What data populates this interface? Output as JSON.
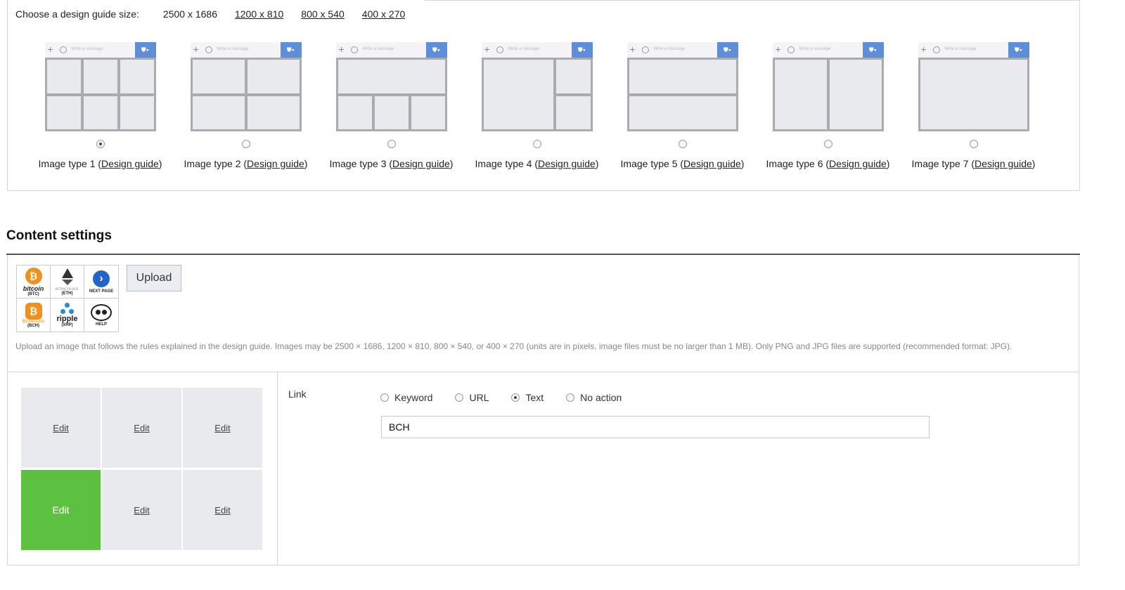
{
  "guide": {
    "size_label": "Choose a design guide size:",
    "sizes": [
      {
        "label": "2500 x 1686",
        "selected": true
      },
      {
        "label": "1200 x 810",
        "selected": false
      },
      {
        "label": "800 x 540",
        "selected": false
      },
      {
        "label": "400 x 270",
        "selected": false
      }
    ],
    "composer_placeholder": "Write a message",
    "design_guide_link": "Design guide",
    "types": [
      {
        "label": "Image type 1",
        "selected": true
      },
      {
        "label": "Image type 2",
        "selected": false
      },
      {
        "label": "Image type 3",
        "selected": false
      },
      {
        "label": "Image type 4",
        "selected": false
      },
      {
        "label": "Image type 5",
        "selected": false
      },
      {
        "label": "Image type 6",
        "selected": false
      },
      {
        "label": "Image type 7",
        "selected": false
      }
    ]
  },
  "content": {
    "title": "Content settings",
    "upload_label": "Upload",
    "upload_note": "Upload an image that follows the rules explained in the design guide. Images may be 2500 × 1686, 1200 × 810, 800 × 540, or 400 × 270 (units are in pixels, image files must be no larger than 1 MB). Only PNG and JPG files are supported (recommended format: JPG).",
    "thumbnail": {
      "btc_brand": "bitcoin",
      "btc_ticker": "(BTC)",
      "eth_brand": "ethereum",
      "eth_ticker": "(ETH)",
      "next_label": "NEXT PAGE",
      "bch_brand": "BitcoinCash",
      "bch_ticker": "(BCH)",
      "xrp_brand": "ripple",
      "xrp_ticker": "(XRP)",
      "help_label": "HELP"
    },
    "edit_label": "Edit",
    "active_cell": 3,
    "link_label": "Link",
    "link_options": [
      "Keyword",
      "URL",
      "Text",
      "No action"
    ],
    "link_selected": "Text",
    "text_value": "BCH"
  },
  "colors": {
    "accent_blue": "#5d8ed9",
    "active_green": "#5cc040",
    "grid_bg": "#e9eaee",
    "grid_line": "#a9abb0"
  }
}
